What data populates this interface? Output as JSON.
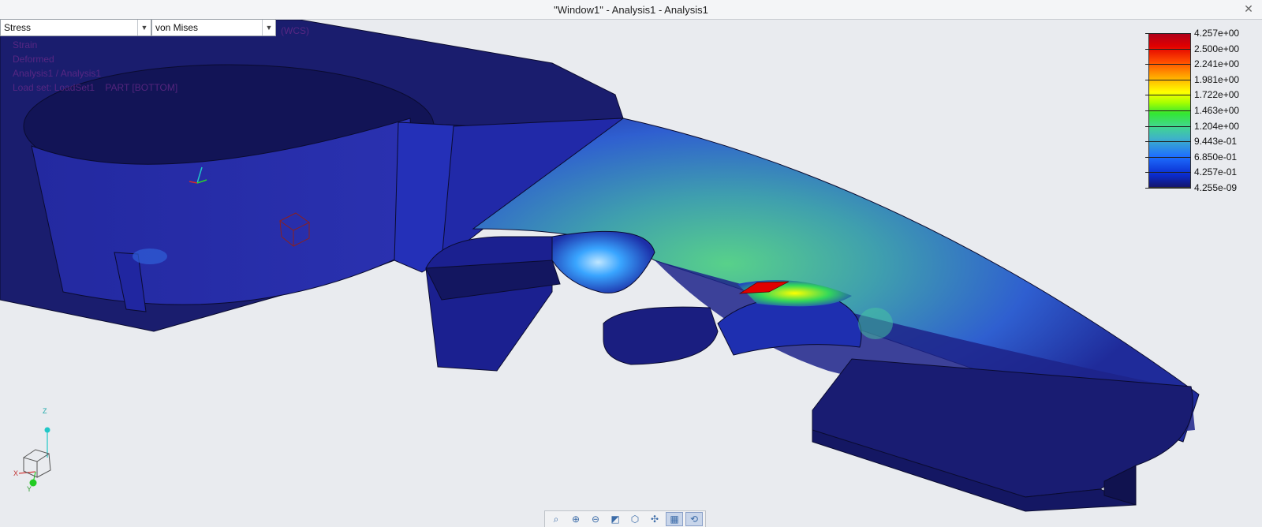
{
  "window": {
    "title": "\"Window1\" - Analysis1 - Analysis1",
    "close_symbol": "✕"
  },
  "result_type": {
    "value": "Stress"
  },
  "component": {
    "value": "von Mises"
  },
  "info_lines": [
    "(WCS)",
    "Strain",
    "Deformed",
    "Analysis1 / Analysis1",
    "Load set: LoadSet1    PART [BOTTOM]"
  ],
  "legend": {
    "values": [
      "4.257e+00",
      "2.500e+00",
      "2.241e+00",
      "1.981e+00",
      "1.722e+00",
      "1.463e+00",
      "1.204e+00",
      "9.443e-01",
      "6.850e-01",
      "4.257e-01",
      "4.255e-09"
    ]
  },
  "triad_labels": {
    "z": "Z",
    "x": "X",
    "y": "Y"
  },
  "toolbar": {
    "buttons": [
      {
        "name": "zoom-fit-icon",
        "glyph": "⌕"
      },
      {
        "name": "zoom-in-icon",
        "glyph": "⊕"
      },
      {
        "name": "zoom-out-icon",
        "glyph": "⊖"
      },
      {
        "name": "refit-icon",
        "glyph": "◩"
      },
      {
        "name": "view-orient-icon",
        "glyph": "⬡"
      },
      {
        "name": "spin-icon",
        "glyph": "✣"
      },
      {
        "name": "display-style-icon",
        "glyph": "▦"
      },
      {
        "name": "animation-icon",
        "glyph": "⟲"
      }
    ]
  },
  "colors": {
    "background": "#e9ebef",
    "part_dark": "#17196a",
    "part_mid": "#2a2fa0",
    "hotspot": "#e10000"
  }
}
